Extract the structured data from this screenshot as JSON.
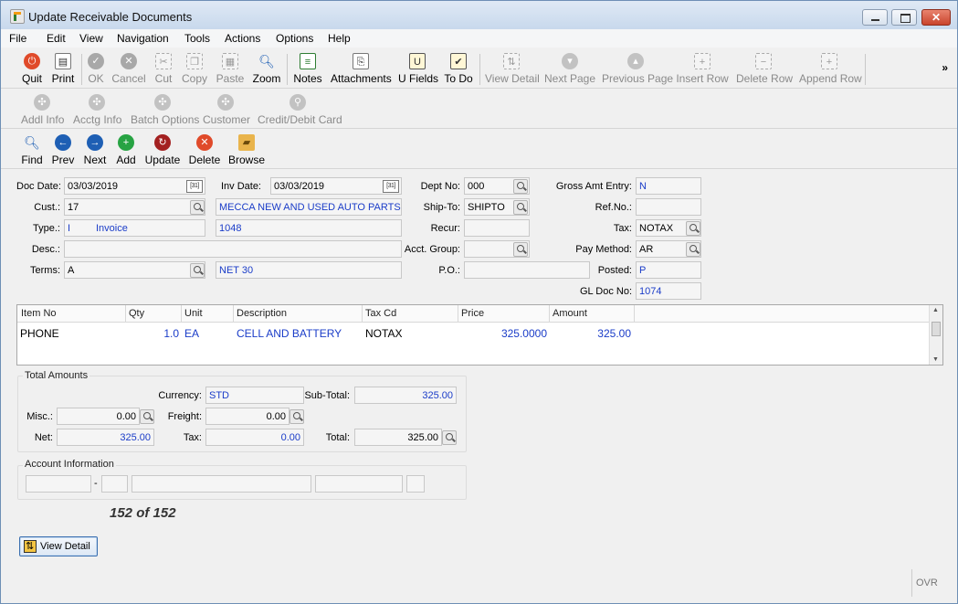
{
  "window": {
    "title": "Update Receivable Documents"
  },
  "menu": [
    "File",
    "Edit",
    "View",
    "Navigation",
    "Tools",
    "Actions",
    "Options",
    "Help"
  ],
  "toolbar1": [
    {
      "label": "Quit",
      "icon": "power-icon",
      "enabled": true
    },
    {
      "label": "Print",
      "icon": "printer-icon",
      "enabled": true
    },
    {
      "label": "OK",
      "icon": "check-icon",
      "enabled": false
    },
    {
      "label": "Cancel",
      "icon": "cancel-icon",
      "enabled": false
    },
    {
      "label": "Cut",
      "icon": "cut-icon",
      "enabled": false
    },
    {
      "label": "Copy",
      "icon": "copy-icon",
      "enabled": false
    },
    {
      "label": "Paste",
      "icon": "paste-icon",
      "enabled": false
    },
    {
      "label": "Zoom",
      "icon": "zoom-icon",
      "enabled": true
    },
    {
      "label": "Notes",
      "icon": "notes-icon",
      "enabled": true
    },
    {
      "label": "Attachments",
      "icon": "paperclip-icon",
      "enabled": true
    },
    {
      "label": "U Fields",
      "icon": "user-fields-icon",
      "enabled": true
    },
    {
      "label": "To Do",
      "icon": "todo-icon",
      "enabled": true
    },
    {
      "label": "View Detail",
      "icon": "view-detail-icon",
      "enabled": false
    },
    {
      "label": "Next Page",
      "icon": "next-page-icon",
      "enabled": false
    },
    {
      "label": "Previous Page",
      "icon": "previous-page-icon",
      "enabled": false
    },
    {
      "label": "Insert Row",
      "icon": "insert-row-icon",
      "enabled": false
    },
    {
      "label": "Delete Row",
      "icon": "delete-row-icon",
      "enabled": false
    },
    {
      "label": "Append Row",
      "icon": "append-row-icon",
      "enabled": false
    }
  ],
  "toolbar1_overflow": "»",
  "toolbar2": [
    {
      "label": "Addl Info",
      "icon": "addl-info-icon"
    },
    {
      "label": "Acctg Info",
      "icon": "acctg-info-icon"
    },
    {
      "label": "Batch Options",
      "icon": "batch-options-icon"
    },
    {
      "label": "Customer",
      "icon": "customer-icon"
    },
    {
      "label": "Credit/Debit Card",
      "icon": "credit-card-icon"
    }
  ],
  "toolbar3": [
    {
      "label": "Find",
      "icon": "find-icon"
    },
    {
      "label": "Prev",
      "icon": "prev-arrow-icon"
    },
    {
      "label": "Next",
      "icon": "next-arrow-icon"
    },
    {
      "label": "Add",
      "icon": "add-icon"
    },
    {
      "label": "Update",
      "icon": "update-icon"
    },
    {
      "label": "Delete",
      "icon": "delete-icon"
    },
    {
      "label": "Browse",
      "icon": "browse-folder-icon"
    }
  ],
  "form": {
    "doc_date_label": "Doc Date:",
    "doc_date": "03/03/2019",
    "inv_date_label": "Inv Date:",
    "inv_date": "03/03/2019",
    "dept_no_label": "Dept No:",
    "dept_no": "000",
    "gross_amt_label": "Gross Amt Entry:",
    "gross_amt": "N",
    "cust_label": "Cust.:",
    "cust": "17",
    "cust_name": "MECCA NEW AND USED AUTO PARTS",
    "ship_to_label": "Ship-To:",
    "ship_to": "SHIPTO",
    "ref_no_label": "Ref.No.:",
    "ref_no": "",
    "type_label": "Type.:",
    "type_code": "I",
    "type_name": "Invoice",
    "type_number": "1048",
    "recur_label": "Recur:",
    "recur": "",
    "tax_label": "Tax:",
    "tax": "NOTAX",
    "desc_label": "Desc.:",
    "desc": "",
    "acct_group_label": "Acct. Group:",
    "acct_group": "",
    "pay_method_label": "Pay Method:",
    "pay_method": "AR",
    "terms_label": "Terms:",
    "terms": "A",
    "terms_name": "NET 30",
    "po_label": "P.O.:",
    "po": "",
    "posted_label": "Posted:",
    "posted": "P",
    "gl_doc_label": "GL Doc No:",
    "gl_doc": "1074",
    "calendar_glyph": "[31]"
  },
  "grid": {
    "columns": [
      "Item No",
      "Qty",
      "Unit",
      "Description",
      "Tax Cd",
      "Price",
      "Amount"
    ],
    "rows": [
      {
        "item_no": "PHONE",
        "qty": "1.0",
        "unit": "EA",
        "description": "CELL AND BATTERY",
        "tax_cd": "NOTAX",
        "price": "325.0000",
        "amount": "325.00"
      }
    ]
  },
  "totals": {
    "title": "Total Amounts",
    "currency_label": "Currency:",
    "currency": "STD",
    "subtotal_label": "Sub-Total:",
    "subtotal": "325.00",
    "misc_label": "Misc.:",
    "misc": "0.00",
    "freight_label": "Freight:",
    "freight": "0.00",
    "net_label": "Net:",
    "net": "325.00",
    "tax_label": "Tax:",
    "tax": "0.00",
    "total_label": "Total:",
    "total": "325.00"
  },
  "account_info": {
    "title": "Account Information",
    "dash": "-"
  },
  "record_counter": "152 of 152",
  "view_detail_button": "View Detail",
  "status": {
    "mode": "OVR"
  }
}
